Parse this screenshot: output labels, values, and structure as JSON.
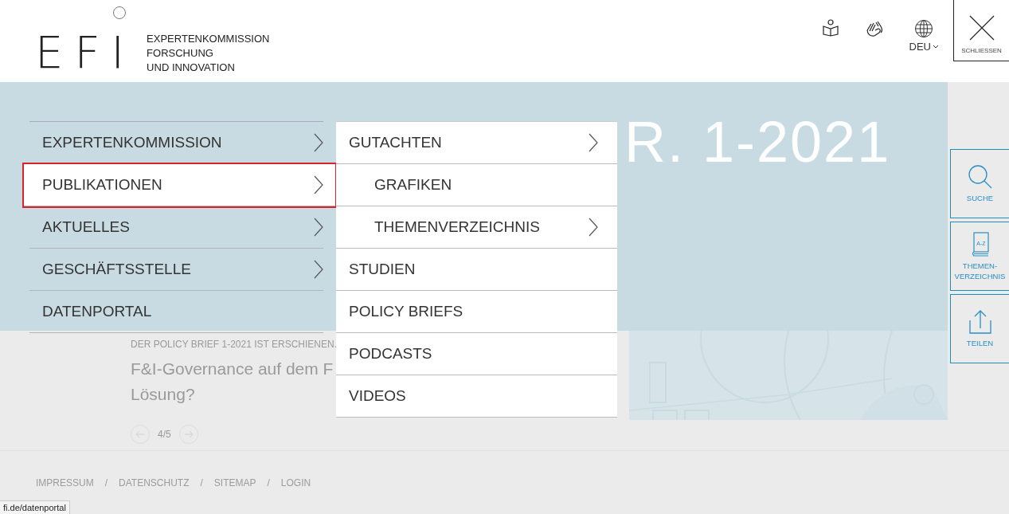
{
  "header": {
    "logo": {
      "letters": "EFI",
      "lines": [
        "EXPERTENKOMMISSION",
        "FORSCHUNG",
        "UND INNOVATION"
      ]
    },
    "language": "DEU",
    "close": "SCHLIESSEN"
  },
  "hero": {
    "title_visible": "R. 1-2021",
    "kicker": "DER POLICY BRIEF 1-2021 IST ERSCHIENEN.",
    "headline_lines": [
      "F&I-Governance auf dem F",
      "Lösung?"
    ],
    "pager": "4/5"
  },
  "menu": {
    "items": [
      {
        "label": "EXPERTENKOMMISSION",
        "selected": false,
        "has_submenu": true
      },
      {
        "label": "PUBLIKATIONEN",
        "selected": true,
        "has_submenu": true
      },
      {
        "label": "AKTUELLES",
        "selected": false,
        "has_submenu": true
      },
      {
        "label": "GESCHÄFTSSTELLE",
        "selected": false,
        "has_submenu": true
      },
      {
        "label": "DATENPORTAL",
        "selected": false,
        "has_submenu": false
      }
    ]
  },
  "submenu": {
    "items": [
      {
        "label": "GUTACHTEN",
        "has_submenu": true,
        "children": [
          {
            "label": "GRAFIKEN",
            "has_submenu": false
          },
          {
            "label": "THEMENVERZEICHNIS",
            "has_submenu": true
          }
        ]
      },
      {
        "label": "STUDIEN",
        "has_submenu": false
      },
      {
        "label": "POLICY BRIEFS",
        "has_submenu": false
      },
      {
        "label": "PODCASTS",
        "has_submenu": false
      },
      {
        "label": "VIDEOS",
        "has_submenu": false
      }
    ]
  },
  "side_tools": [
    {
      "kind": "search",
      "lines": [
        "SUCHE"
      ]
    },
    {
      "kind": "index",
      "lines": [
        "THEMEN-",
        "VERZEICHNIS"
      ],
      "icon_text": "A-Z"
    },
    {
      "kind": "share",
      "lines": [
        "TEILEN"
      ]
    }
  ],
  "footer": {
    "links": [
      "IMPRESSUM",
      "DATENSCHUTZ",
      "SITEMAP",
      "LOGIN"
    ],
    "separator": "/"
  },
  "status_url": "fi.de/datenportal"
}
